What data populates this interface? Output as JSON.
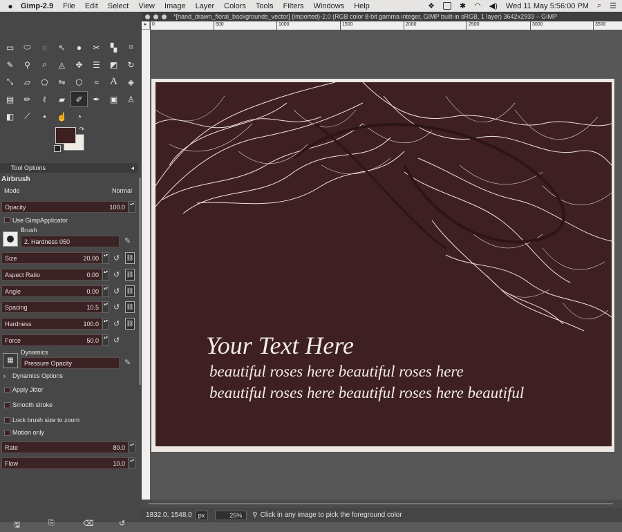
{
  "menubar": {
    "apple": "",
    "app_name": "Gimp-2.9",
    "items": [
      "File",
      "Edit",
      "Select",
      "View",
      "Image",
      "Layer",
      "Colors",
      "Tools",
      "Filters",
      "Windows",
      "Help"
    ],
    "clock": "Wed 11 May  5:56:00 PM"
  },
  "toolbox": {
    "dock_tab": "Tool Options",
    "tool_name": "Airbrush",
    "mode_label": "Mode",
    "mode_value": "Normal",
    "opacity": {
      "label": "Opacity",
      "value": "100.0"
    },
    "use_gimp_applicator": "Use GimpApplicator",
    "brush_label": "Brush",
    "brush_value": "2. Hardness 050",
    "size": {
      "label": "Size",
      "value": "20.00"
    },
    "aspect_ratio": {
      "label": "Aspect Ratio",
      "value": "0.00"
    },
    "angle": {
      "label": "Angle",
      "value": "0.00"
    },
    "spacing": {
      "label": "Spacing",
      "value": "10.5"
    },
    "hardness": {
      "label": "Hardness",
      "value": "100.0"
    },
    "force": {
      "label": "Force",
      "value": "50.0"
    },
    "dynamics_label": "Dynamics",
    "dynamics_value": "Pressure Opacity",
    "dynamics_options": "Dynamics Options",
    "apply_jitter": "Apply Jitter",
    "smooth_stroke": "Smooth stroke",
    "lock_brush": "Lock brush size to zoom",
    "motion_only": "Motion only",
    "rate": {
      "label": "Rate",
      "value": "80.0"
    },
    "flow": {
      "label": "Flow",
      "value": "10.0"
    },
    "fg_color": "#3e2021",
    "bg_color": "#efeae4"
  },
  "image_window": {
    "title": "*[hand_drawn_floral_backgrounds_vector] (imported)-2.0 (RGB color 8-bit gamma integer, GIMP built-in sRGB, 1 layer) 3642x2933 – GIMP",
    "ruler_ticks": [
      "0",
      "500",
      "1000",
      "1500",
      "2000",
      "2500",
      "3000",
      "3500"
    ],
    "canvas_text": {
      "line1": "Your Text Here",
      "line2": "beautiful roses here beautiful roses here",
      "line3": "beautiful roses here beautiful roses here beautiful"
    },
    "canvas_bg": "#3f2022",
    "status": {
      "coords": "1832.0, 1548.0",
      "unit": "px",
      "zoom": "25%",
      "message": "Click in any image to pick the foreground color"
    }
  }
}
